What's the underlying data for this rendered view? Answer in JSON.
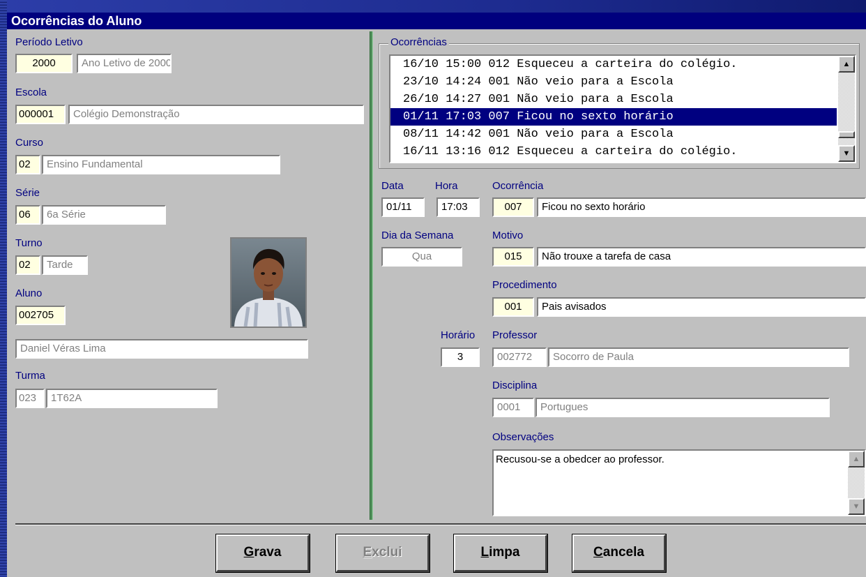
{
  "window": {
    "title": "Ocorrências do Aluno"
  },
  "left": {
    "periodo_label": "Período Letivo",
    "periodo_code": "2000",
    "periodo_desc": "Ano Letivo de 2000",
    "escola_label": "Escola",
    "escola_code": "000001",
    "escola_desc": "Colégio Demonstração",
    "curso_label": "Curso",
    "curso_code": "02",
    "curso_desc": "Ensino Fundamental",
    "serie_label": "Série",
    "serie_code": "06",
    "serie_desc": "6a Série",
    "turno_label": "Turno",
    "turno_code": "02",
    "turno_desc": "Tarde",
    "aluno_label": "Aluno",
    "aluno_code": "002705",
    "aluno_name": "Daniel Véras Lima",
    "turma_label": "Turma",
    "turma_code": "023",
    "turma_desc": "1T62A"
  },
  "occurrences": {
    "caption": "Ocorrências",
    "items": [
      "16/10 15:00 012 Esqueceu a carteira do colégio.",
      "23/10 14:24 001 Não veio para a Escola",
      "26/10 14:27 001 Não veio para a Escola",
      "01/11 17:03 007 Ficou no sexto horário",
      "08/11 14:42 001 Não veio para a Escola",
      "16/11 13:16 012 Esqueceu a carteira do colégio."
    ],
    "selected_index": 3
  },
  "detail": {
    "data_label": "Data",
    "data_value": "01/11",
    "hora_label": "Hora",
    "hora_value": "17:03",
    "ocorrencia_label": "Ocorrência",
    "ocorrencia_code": "007",
    "ocorrencia_desc": "Ficou no sexto horário",
    "dia_label": "Dia da Semana",
    "dia_value": "Qua",
    "motivo_label": "Motivo",
    "motivo_code": "015",
    "motivo_desc": "Não trouxe a tarefa de casa",
    "procedimento_label": "Procedimento",
    "procedimento_code": "001",
    "procedimento_desc": "Pais avisados",
    "horario_label": "Horário",
    "horario_value": "3",
    "professor_label": "Professor",
    "professor_code": "002772",
    "professor_name": "Socorro de Paula",
    "disciplina_label": "Disciplina",
    "disciplina_code": "0001",
    "disciplina_desc": "Portugues",
    "observacoes_label": "Observações",
    "observacoes_value": "Recusou-se a obedcer ao professor."
  },
  "buttons": {
    "grava_accel": "G",
    "grava_rest": "rava",
    "exclui_accel": "E",
    "exclui_rest": "xclui",
    "limpa_accel": "L",
    "limpa_rest": "impa",
    "cancela_accel": "C",
    "cancela_rest": "ancela"
  }
}
